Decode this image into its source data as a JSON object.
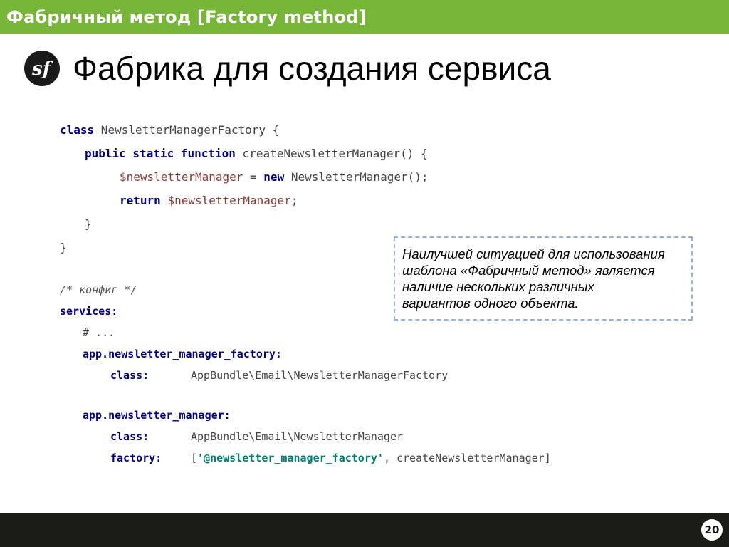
{
  "header": {
    "title": "Фабричный метод [Factory method]"
  },
  "slide": {
    "heading": "Фабрика для создания сервиса",
    "logo_icon": "symfony-logo-icon",
    "logo_letters": "sf"
  },
  "code": {
    "l1": {
      "k": "class",
      "t": " NewsletterManagerFactory {"
    },
    "l2": {
      "k": "public static function",
      "t": " createNewsletterManager() {"
    },
    "l3": {
      "v": "$newsletterManager",
      "t1": " = ",
      "k": "new",
      "t2": " NewsletterManager();"
    },
    "l4": {
      "k": "return",
      "v": " $newsletterManager",
      "t": ";"
    },
    "l5": "}",
    "l6": "}"
  },
  "config": {
    "comment": "/* конфиг */",
    "services": "services:",
    "ellipsis": "# ...",
    "svc1_key": "app.newsletter_manager_factory:",
    "svc1_class_key": "class:",
    "svc1_class_val": "AppBundle\\Email\\NewsletterManagerFactory",
    "svc2_key": "app.newsletter_manager:",
    "svc2_class_key": "class:",
    "svc2_class_val": "AppBundle\\Email\\NewsletterManager",
    "svc2_factory_key": "factory:",
    "svc2_factory_open": "[",
    "svc2_factory_ref": "'@newsletter_manager_factory'",
    "svc2_factory_rest": ", createNewsletterManager]"
  },
  "note": {
    "text": "Наилучшей ситуацией для использования\nшаблона «Фабричный метод» является\nналичие нескольких различных\nвариантов одного объекта."
  },
  "footer": {
    "page_number": "20"
  },
  "colors": {
    "header_bg": "#77b638",
    "footer_bg": "#1b1b17",
    "keyword": "#000080",
    "variable": "#8b3a3a",
    "string": "#00806e",
    "note_border": "#8fb0e0"
  }
}
